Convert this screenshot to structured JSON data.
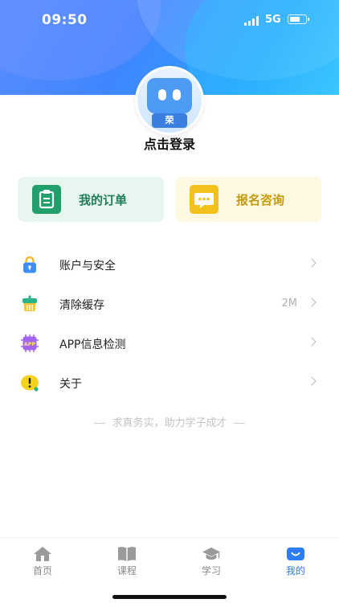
{
  "status_bar": {
    "time": "09:50",
    "network": "5G"
  },
  "profile": {
    "login_prompt": "点击登录",
    "avatar_badge": "荣"
  },
  "cards": {
    "orders": {
      "label": "我的订单",
      "icon": "order-clipboard-icon"
    },
    "consult": {
      "label": "报名咨询",
      "icon": "chat-bubble-icon"
    }
  },
  "menu": [
    {
      "label": "账户与安全",
      "value": "",
      "icon": "lock-icon"
    },
    {
      "label": "清除缓存",
      "value": "2M",
      "icon": "broom-icon"
    },
    {
      "label": "APP信息检测",
      "value": "",
      "icon": "app-chip-icon",
      "icon_text": "APP"
    },
    {
      "label": "关于",
      "value": "",
      "icon": "info-alert-icon"
    }
  ],
  "slogan": "求真务实，助力学子成才",
  "tabs": [
    {
      "label": "首页",
      "icon": "home-icon",
      "active": false
    },
    {
      "label": "课程",
      "icon": "book-icon",
      "active": false
    },
    {
      "label": "学习",
      "icon": "graduation-cap-icon",
      "active": false
    },
    {
      "label": "我的",
      "icon": "profile-icon",
      "active": true
    }
  ],
  "colors": {
    "accent": "#2c7ef8",
    "orders_bg": "#e7f6ef",
    "orders_icon": "#22a06b",
    "consult_bg": "#fdf8e2",
    "consult_icon": "#f3c21a"
  }
}
